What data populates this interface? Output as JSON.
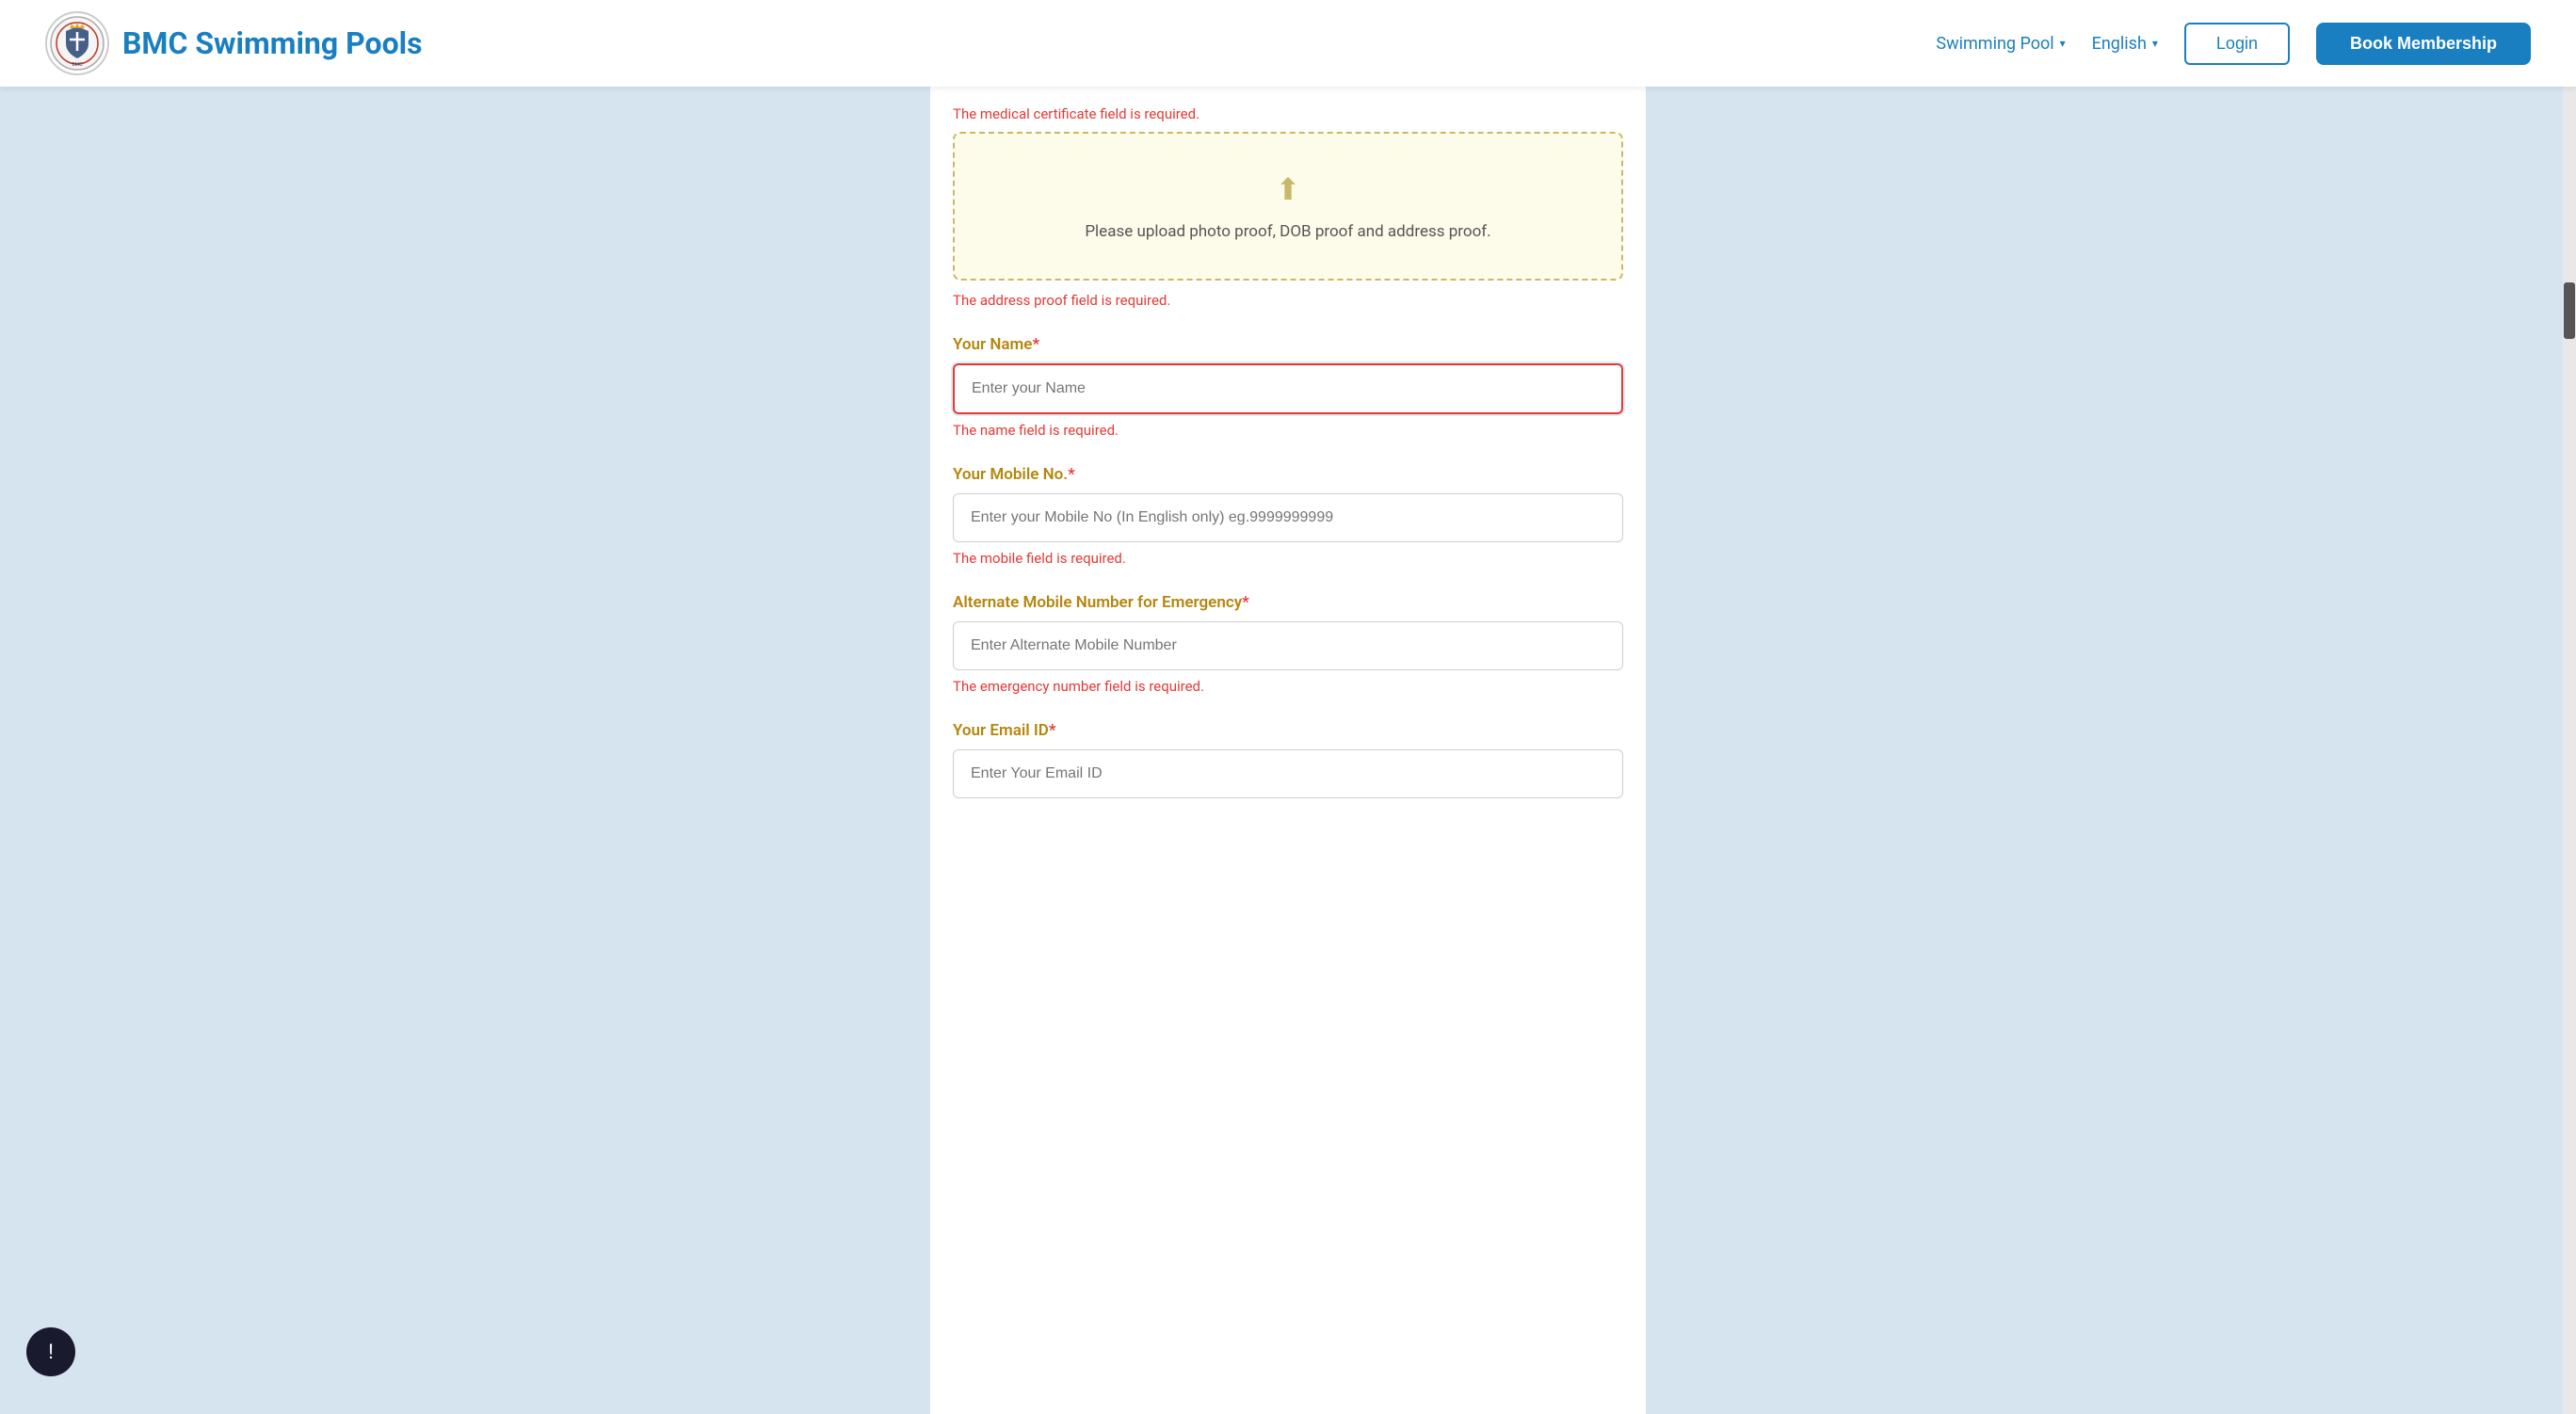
{
  "navbar": {
    "title": "BMC Swimming Pools",
    "logo_alt": "BMC Logo",
    "nav_items": [
      {
        "label": "Swimming Pool",
        "has_dropdown": true
      },
      {
        "label": "English",
        "has_dropdown": true
      }
    ],
    "login_label": "Login",
    "book_label": "Book Membership"
  },
  "form": {
    "medical_cert_error": "The medical certificate field is required.",
    "upload_text": "Please upload photo proof, DOB proof and address proof.",
    "address_proof_error": "The address proof field is required.",
    "name_label": "Your Name",
    "name_required": "*",
    "name_placeholder": "Enter your Name",
    "name_error": "The name field is required.",
    "mobile_label": "Your Mobile No.",
    "mobile_required": "*",
    "mobile_placeholder": "Enter your Mobile No (In English only) eg.9999999999",
    "mobile_error": "The mobile field is required.",
    "alt_mobile_label": "Alternate Mobile Number for Emergency",
    "alt_mobile_required": "*",
    "alt_mobile_placeholder": "Enter Alternate Mobile Number",
    "alt_mobile_error": "The emergency number field is required.",
    "email_label": "Your Email ID",
    "email_required": "*",
    "email_placeholder": "Enter Your Email ID"
  },
  "icons": {
    "upload": "⬆",
    "chevron": "▾",
    "feedback": "!"
  }
}
